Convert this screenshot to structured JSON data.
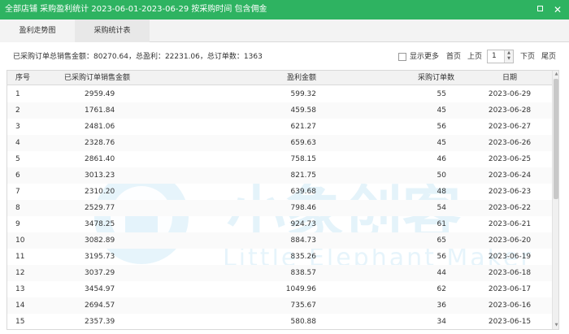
{
  "window": {
    "title": "全部店铺 采购盈利统计 2023-06-01-2023-06-29 按采购时间 包含佣金"
  },
  "tabs": [
    {
      "label": "盈利走势图"
    },
    {
      "label": "采购统计表"
    }
  ],
  "summary": {
    "text": "已采购订单总销售金额：80270.64，总盈利：22231.06，总订单数：1363"
  },
  "pager": {
    "show_more": "显示更多",
    "first": "首页",
    "prev": "上页",
    "page": "1",
    "next": "下页",
    "last": "尾页"
  },
  "table": {
    "headers": [
      "序号",
      "已采购订单销售金额",
      "盈利金额",
      "采购订单数",
      "日期"
    ],
    "rows": [
      [
        "1",
        "2959.49",
        "599.32",
        "55",
        "2023-06-29"
      ],
      [
        "2",
        "1761.84",
        "459.58",
        "45",
        "2023-06-28"
      ],
      [
        "3",
        "2481.06",
        "621.27",
        "56",
        "2023-06-27"
      ],
      [
        "4",
        "2328.76",
        "659.63",
        "45",
        "2023-06-26"
      ],
      [
        "5",
        "2861.40",
        "758.15",
        "46",
        "2023-06-25"
      ],
      [
        "6",
        "3013.23",
        "821.75",
        "50",
        "2023-06-24"
      ],
      [
        "7",
        "2310.20",
        "639.68",
        "48",
        "2023-06-23"
      ],
      [
        "8",
        "2529.77",
        "798.46",
        "54",
        "2023-06-22"
      ],
      [
        "9",
        "3478.25",
        "924.73",
        "61",
        "2023-06-21"
      ],
      [
        "10",
        "3082.89",
        "884.73",
        "65",
        "2023-06-20"
      ],
      [
        "11",
        "3195.73",
        "835.26",
        "56",
        "2023-06-19"
      ],
      [
        "12",
        "3037.29",
        "838.57",
        "44",
        "2023-06-18"
      ],
      [
        "13",
        "3454.97",
        "1049.96",
        "62",
        "2023-06-17"
      ],
      [
        "14",
        "2694.57",
        "735.67",
        "36",
        "2023-06-16"
      ],
      [
        "15",
        "2357.39",
        "580.88",
        "34",
        "2023-06-15"
      ]
    ]
  },
  "watermark": {
    "cn": "小象创客",
    "en": "Little Elephant Maker"
  },
  "colors": {
    "accent": "#2eb361",
    "watermark": "#3aa8e0"
  }
}
